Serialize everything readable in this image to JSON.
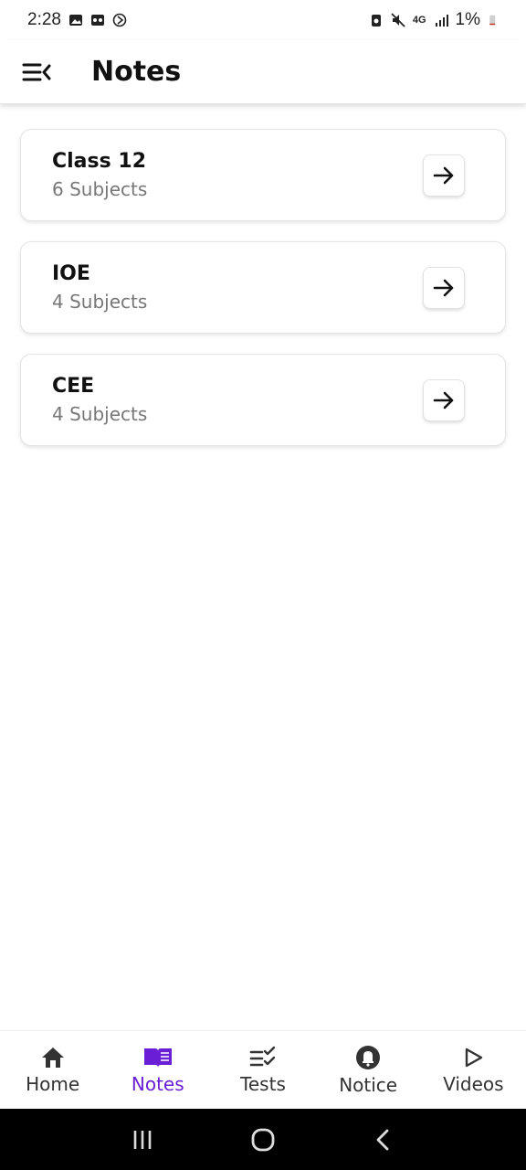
{
  "status_bar": {
    "time": "2:28",
    "battery": "1%",
    "network": "4G"
  },
  "header": {
    "title": "Notes"
  },
  "categories": [
    {
      "title": "Class 12",
      "subtitle": "6 Subjects"
    },
    {
      "title": "IOE",
      "subtitle": "4 Subjects"
    },
    {
      "title": "CEE",
      "subtitle": "4 Subjects"
    }
  ],
  "bottom_nav": {
    "items": [
      {
        "label": "Home",
        "icon": "home-icon"
      },
      {
        "label": "Notes",
        "icon": "book-icon",
        "active": true
      },
      {
        "label": "Tests",
        "icon": "checklist-icon"
      },
      {
        "label": "Notice",
        "icon": "bell-icon"
      },
      {
        "label": "Videos",
        "icon": "play-icon"
      }
    ]
  },
  "colors": {
    "accent": "#6a1fd6"
  }
}
